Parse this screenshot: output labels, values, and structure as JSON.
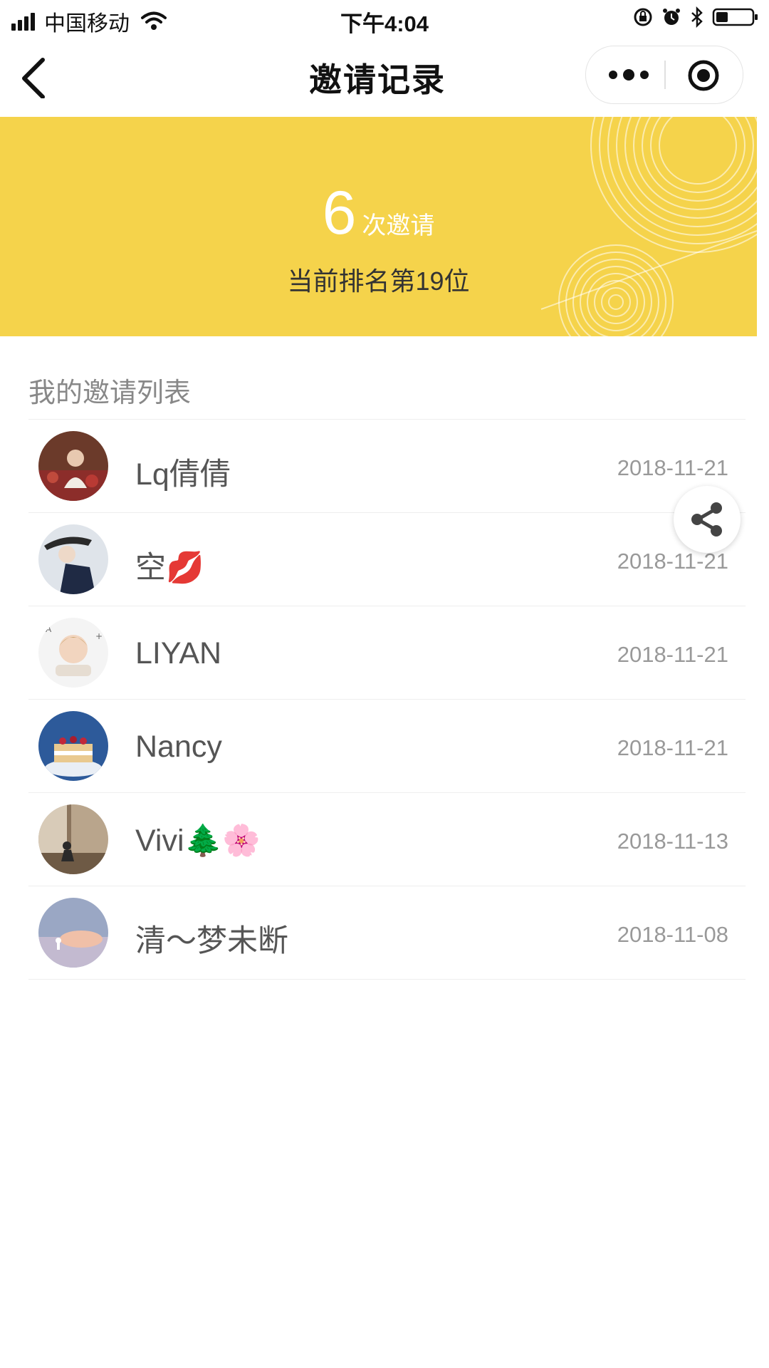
{
  "status_bar": {
    "carrier": "中国移动",
    "time": "下午4:04"
  },
  "nav": {
    "title": "邀请记录"
  },
  "banner": {
    "count": "6",
    "count_unit": "次邀请",
    "rank_text": "当前排名第19位",
    "background_color": "#f5d34b"
  },
  "list": {
    "section_title": "我的邀请列表",
    "items": [
      {
        "name": "Lq倩倩",
        "date": "2018-11-21",
        "avatar_icon": "girl-in-flowers-avatar"
      },
      {
        "name": "空💋",
        "date": "2018-11-21",
        "avatar_icon": "woman-with-hat-avatar"
      },
      {
        "name": "LIYAN",
        "date": "2018-11-21",
        "avatar_icon": "child-avatar"
      },
      {
        "name": "Nancy",
        "date": "2018-11-21",
        "avatar_icon": "cake-avatar"
      },
      {
        "name": "Vivi🌲🌸",
        "date": "2018-11-13",
        "avatar_icon": "room-avatar"
      },
      {
        "name": "清～梦未断",
        "date": "2018-11-08",
        "avatar_icon": "sky-avatar"
      }
    ]
  },
  "icons": {
    "back": "chevron-left-icon",
    "more": "more-dots-icon",
    "close": "target-icon",
    "share": "share-icon"
  }
}
